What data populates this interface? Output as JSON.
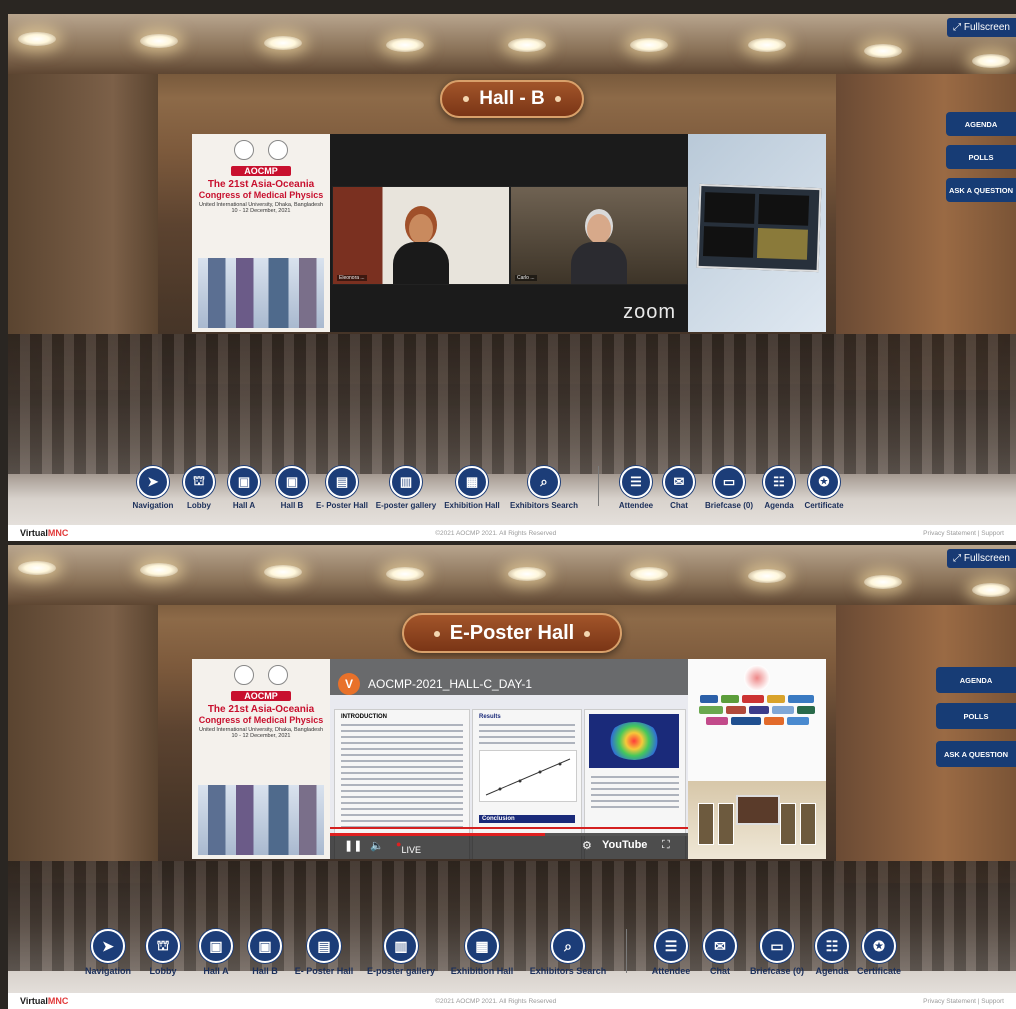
{
  "footer": {
    "brand_prefix": "Virtual",
    "brand_suffix": "MNC",
    "copyright": "©2021 AOCMP 2021. All Rights Reserved",
    "links": "Privacy Statement | Support"
  },
  "fullscreen_label": "Fullscreen",
  "side_buttons": [
    "AGENDA",
    "POLLS",
    "ASK A QUESTION"
  ],
  "nav_left": [
    {
      "label": "Navigation",
      "icon": "navigation-icon",
      "glyph": "➤"
    },
    {
      "label": "Lobby",
      "icon": "lobby-icon",
      "glyph": "⛫"
    },
    {
      "label": "Hall A",
      "icon": "hall-a-icon",
      "glyph": "▣"
    },
    {
      "label": "Hall B",
      "icon": "hall-b-icon",
      "glyph": "▣"
    },
    {
      "label": "E- Poster Hall",
      "icon": "eposter-hall-icon",
      "glyph": "▤"
    },
    {
      "label": "E-poster gallery",
      "icon": "eposter-gallery-icon",
      "glyph": "▥"
    },
    {
      "label": "Exhibition Hall",
      "icon": "exhibition-hall-icon",
      "glyph": "▦"
    },
    {
      "label": "Exhibitors Search",
      "icon": "exhibitors-search-icon",
      "glyph": "⌕"
    }
  ],
  "nav_right": [
    {
      "label": "Attendee",
      "icon": "attendee-icon",
      "glyph": "☰"
    },
    {
      "label": "Chat",
      "icon": "chat-icon",
      "glyph": "✉"
    },
    {
      "label": "Briefcase (0)",
      "icon": "briefcase-icon",
      "glyph": "▭"
    },
    {
      "label": "Agenda",
      "icon": "agenda-icon",
      "glyph": "☷"
    },
    {
      "label": "Certificate",
      "icon": "certificate-icon",
      "glyph": "✪"
    }
  ],
  "conference_poster": {
    "brand": "AOCMP",
    "title_line1": "The 21st Asia-Oceania",
    "title_line2": "Congress of Medical Physics",
    "venue": "United International University, Dhaka, Bangladesh",
    "dates": "10 - 12 December, 2021"
  },
  "screen1": {
    "hall_title": "Hall - B",
    "zoom_label": "zoom",
    "participants": [
      "Eleonora ...",
      "Carlo ..."
    ]
  },
  "screen2": {
    "hall_title": "E-Poster Hall",
    "channel_initial": "V",
    "video_title": "AOCMP-2021_HALL-C_DAY-1",
    "live_label": "LIVE",
    "platform_label": "YouTube",
    "poster_sections": [
      "INTRODUCTION",
      "Results",
      "Conclusion"
    ],
    "progress": 0.6
  },
  "colors": {
    "accent_blue": "#1c3d78",
    "banner_brown": "#8a3f1e",
    "brand_red": "#c8102e"
  }
}
